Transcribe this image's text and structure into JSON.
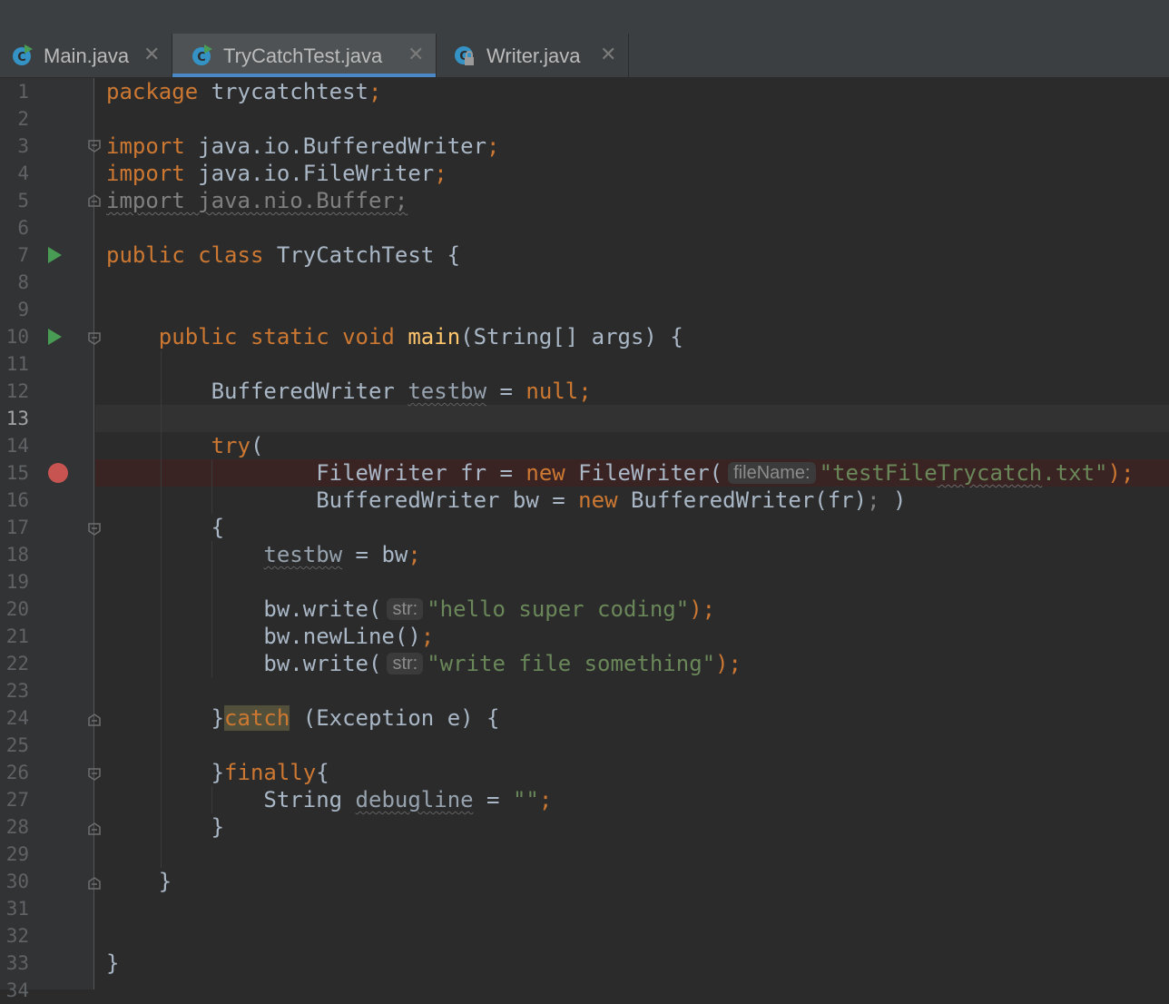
{
  "tabs": [
    {
      "label": "Main.java",
      "active": false,
      "icon": "java-class-run-icon"
    },
    {
      "label": "TryCatchTest.java",
      "active": true,
      "icon": "java-class-run-icon"
    },
    {
      "label": "Writer.java",
      "active": false,
      "icon": "java-class-locked-icon"
    }
  ],
  "gutter": {
    "line_numbers": [
      "1",
      "2",
      "3",
      "4",
      "5",
      "6",
      "7",
      "8",
      "9",
      "10",
      "11",
      "12",
      "13",
      "14",
      "15",
      "16",
      "17",
      "18",
      "19",
      "20",
      "21",
      "22",
      "23",
      "24",
      "25",
      "26",
      "27",
      "28",
      "29",
      "30",
      "31",
      "32",
      "33",
      "34"
    ],
    "run_markers": [
      "7",
      "10"
    ],
    "breakpoint_lines": [
      "15"
    ],
    "current_line": "13"
  },
  "code": {
    "l1": [
      "package",
      " trycatchtest",
      ";"
    ],
    "l3": [
      "import",
      " java.io.BufferedWriter",
      ";"
    ],
    "l4": [
      "import",
      " java.io.FileWriter",
      ";"
    ],
    "l5": "import java.nio.Buffer;",
    "l7": [
      "public class",
      " TryCatchTest {"
    ],
    "l10": [
      "public static void",
      "main",
      "(String[] args) {"
    ],
    "l12": [
      "BufferedWriter ",
      "testbw",
      " = ",
      "null",
      ";"
    ],
    "l14": [
      "try",
      "("
    ],
    "l15": [
      "FileWriter fr = ",
      "new",
      " FileWriter(",
      "fileName:",
      "\"testFile",
      "Trycatch",
      ".txt\"",
      ");"
    ],
    "l16": [
      "BufferedWriter bw = ",
      "new",
      " BufferedWriter(fr)",
      ";",
      " )"
    ],
    "l17": "{",
    "l18": [
      "testbw",
      " = bw",
      ";"
    ],
    "l20": [
      "bw.write(",
      "str:",
      "\"hello super coding\"",
      ");"
    ],
    "l21": [
      "bw.newLine()",
      ";"
    ],
    "l22": [
      "bw.write(",
      "str:",
      "\"write file something\"",
      ");"
    ],
    "l24": [
      "}",
      "catch",
      " (Exception e) {"
    ],
    "l26": [
      "}",
      "finally",
      "{"
    ],
    "l27": [
      "String ",
      "debugline",
      " = ",
      "\"\"",
      ";"
    ],
    "l28": "}",
    "l30": "}",
    "l33": "}"
  },
  "colors": {
    "background": "#2b2b2b",
    "gutter": "#313335",
    "keyword": "#cc7832",
    "string": "#6a8759",
    "function": "#ffc66d",
    "text": "#a9b7c6",
    "line_number": "#606366",
    "breakpoint": "#c75450",
    "run_marker": "#499c54",
    "tab_underline": "#4a88c7",
    "breakpoint_line": "#3a2323",
    "current_line": "#323232"
  }
}
